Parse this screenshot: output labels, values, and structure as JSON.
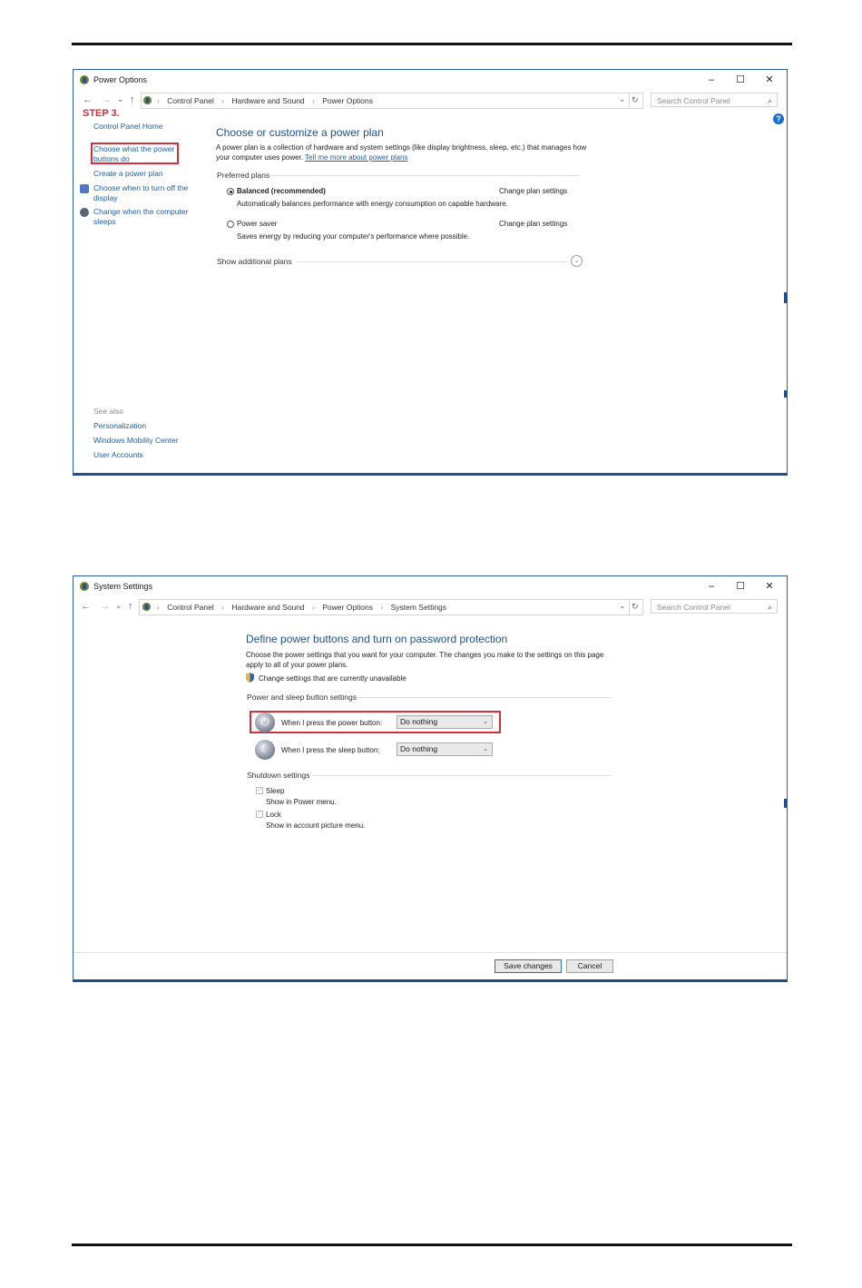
{
  "window1": {
    "title": "Power Options",
    "breadcrumb": [
      "Control Panel",
      "Hardware and Sound",
      "Power Options"
    ],
    "search_placeholder": "Search Control Panel",
    "step_label": "STEP 3.",
    "sidebar": {
      "home": "Control Panel Home",
      "items": [
        {
          "label": "Choose what the power buttons do"
        },
        {
          "label": "Create a power plan"
        },
        {
          "label": "Choose when to turn off the display"
        },
        {
          "label": "Change when the computer sleeps"
        }
      ],
      "see_also": "See also",
      "see_also_items": [
        "Personalization",
        "Windows Mobility Center",
        "User Accounts"
      ]
    },
    "main": {
      "heading": "Choose or customize a power plan",
      "desc_text": "A power plan is a collection of hardware and system settings (like display brightness, sleep, etc.) that manages how your computer uses power.",
      "desc_link": "Tell me more about power plans",
      "group_header": "Preferred plans",
      "plans": [
        {
          "name": "Balanced (recommended)",
          "desc": "Automatically balances performance with energy consumption on capable hardware.",
          "link": "Change plan settings",
          "selected": true
        },
        {
          "name": "Power saver",
          "desc": "Saves energy by reducing your computer's performance where possible.",
          "link": "Change plan settings",
          "selected": false
        }
      ],
      "show_additional": "Show additional plans"
    }
  },
  "window2": {
    "title": "System Settings",
    "breadcrumb": [
      "Control Panel",
      "Hardware and Sound",
      "Power Options",
      "System Settings"
    ],
    "search_placeholder": "Search Control Panel",
    "heading": "Define power buttons and turn on password protection",
    "desc": "Choose the power settings that you want for your computer. The changes you make to the settings on this page apply to all of your power plans.",
    "change_link": "Change settings that are currently unavailable",
    "group_header": "Power and sleep button settings",
    "power_label": "When I press the power button:",
    "power_value": "Do nothing",
    "sleep_label": "When I press the sleep button:",
    "sleep_value": "Do nothing",
    "shutdown_header": "Shutdown settings",
    "shutdown_items": [
      {
        "label": "Sleep",
        "desc": "Show in Power menu.",
        "checked": true
      },
      {
        "label": "Lock",
        "desc": "Show in account picture menu.",
        "checked": true
      }
    ],
    "save_label": "Save changes",
    "cancel_label": "Cancel"
  },
  "icons": {
    "minimize": "–",
    "maximize": "☐",
    "close": "✕",
    "back": "←",
    "forward": "→",
    "recent": "⌄",
    "up": "↑",
    "refresh": "↻",
    "search": "⌕",
    "dropdown": "⌄",
    "help": "?"
  },
  "colors": {
    "link": "#1c5fb3",
    "heading": "#1d4f9a",
    "highlight": "#d32f3c",
    "frame": "#1f4e8c"
  }
}
